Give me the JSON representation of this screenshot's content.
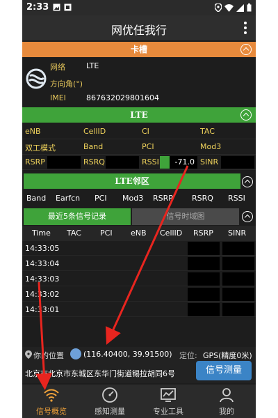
{
  "status_bar": {
    "time": "2:33"
  },
  "app_bar": {
    "title": "网优任我行"
  },
  "sim_section": {
    "title": "卡槽"
  },
  "sim_card": {
    "network_label": "网络",
    "network_value": "LTE",
    "direction_label": "方向角(°)",
    "direction_value": "",
    "imei_label": "IMEI",
    "imei_value": "867632029801604"
  },
  "lte_section": {
    "title": "LTE"
  },
  "lte_grid": {
    "row1": [
      "eNB",
      "CellID",
      "CI",
      "TAC"
    ],
    "row2": [
      "双工模式",
      "Band",
      "PCI",
      "Mod3"
    ],
    "row3": [
      "RSRP",
      "RSRQ",
      "RSSI",
      "SINR"
    ],
    "rssi_value": "-71.0",
    "rssi_level": 0.25
  },
  "neighbor_section": {
    "title": "LTE邻区"
  },
  "neighbor_headers": [
    "Band",
    "Earfcn",
    "PCI",
    "Mod3",
    "RSRP",
    "RSRQ",
    "RSSI"
  ],
  "record_tabs": {
    "active": "最近5条信号记录",
    "inactive": "信号时域图"
  },
  "record_headers": [
    "Time",
    "TAC",
    "PCI",
    "eNB",
    "CellID",
    "RSRP",
    "SINR"
  ],
  "records": [
    "14:33:05",
    "14:33:04",
    "14:33:03",
    "14:33:02",
    "14:33:01"
  ],
  "location": {
    "label": "你的位置",
    "coords": "(116.40400, 39.91500)",
    "position_label": "定位:",
    "gps": "GPS(精度0米)",
    "address": "北京市北京市东城区东华门街道锡拉胡同6号",
    "measure_button": "信号测量"
  },
  "bottom_nav": [
    {
      "label": "信号概览",
      "icon": "wifi-icon"
    },
    {
      "label": "感知测量",
      "icon": "gauge-icon"
    },
    {
      "label": "专业工具",
      "icon": "chart-icon"
    },
    {
      "label": "我的",
      "icon": "person-icon"
    }
  ],
  "colors": {
    "accent_orange": "#e78a3c",
    "accent_green": "#3fa33a",
    "button_blue": "#3b84c6",
    "label_yellow": "#f2d55c",
    "arrow_red": "#e8251f"
  }
}
